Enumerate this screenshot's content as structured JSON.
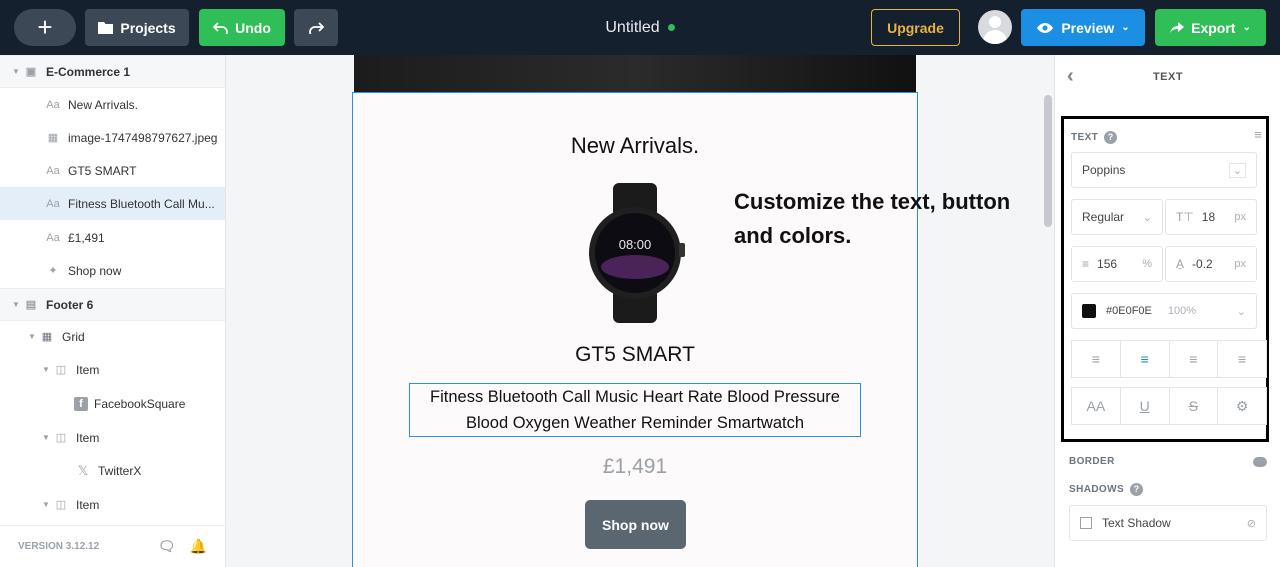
{
  "topbar": {
    "add_icon": "plus-icon",
    "projects_label": "Projects",
    "undo_label": "Undo",
    "title": "Untitled",
    "upgrade_label": "Upgrade",
    "preview_label": "Preview",
    "export_label": "Export"
  },
  "layers": [
    {
      "label": "E-Commerce 1",
      "icon": "cart-icon"
    },
    {
      "label": "New Arrivals.",
      "icon": "text-icon"
    },
    {
      "label": "image-1747498797627.jpeg",
      "icon": "image-icon"
    },
    {
      "label": "GT5 SMART",
      "icon": "text-icon"
    },
    {
      "label": "Fitness Bluetooth Call Mu...",
      "icon": "text-icon"
    },
    {
      "label": "£1,491",
      "icon": "text-icon"
    },
    {
      "label": "Shop now",
      "icon": "click-icon"
    },
    {
      "label": "Footer 6",
      "icon": "footer-icon"
    },
    {
      "label": "Grid",
      "icon": "grid-icon"
    },
    {
      "label": "Item",
      "icon": "item-icon"
    },
    {
      "label": "FacebookSquare",
      "icon": "facebook-icon"
    },
    {
      "label": "Item",
      "icon": "item-icon"
    },
    {
      "label": "TwitterX",
      "icon": "x-icon"
    },
    {
      "label": "Item",
      "icon": "item-icon"
    }
  ],
  "version": "VERSION 3.12.12",
  "canvas": {
    "heading": "New Arrivals.",
    "product_name": "GT5 SMART",
    "description": "Fitness Bluetooth Call Music Heart Rate Blood Pressure Blood Oxygen Weather Reminder Smartwatch",
    "price": "£1,491",
    "button_label": "Shop now",
    "callout": "Customize the text, button and colors.",
    "watch_time": "08:00"
  },
  "panel": {
    "header": "TEXT",
    "section_label": "TEXT",
    "font_family": "Poppins",
    "font_weight": "Regular",
    "font_size": "18",
    "font_size_unit": "px",
    "line_height": "156",
    "line_height_unit": "%",
    "letter_spacing": "-0.2",
    "letter_spacing_unit": "px",
    "color_hex": "#0E0F0E",
    "color_opacity": "100%",
    "case_label": "AA",
    "border_label": "BORDER",
    "shadows_label": "SHADOWS",
    "text_shadow_label": "Text Shadow"
  },
  "colors": {
    "accent": "#1a8fe3",
    "green": "#2fbe57",
    "upgrade": "#e8b53c",
    "text_color": "#0e0f0e"
  }
}
